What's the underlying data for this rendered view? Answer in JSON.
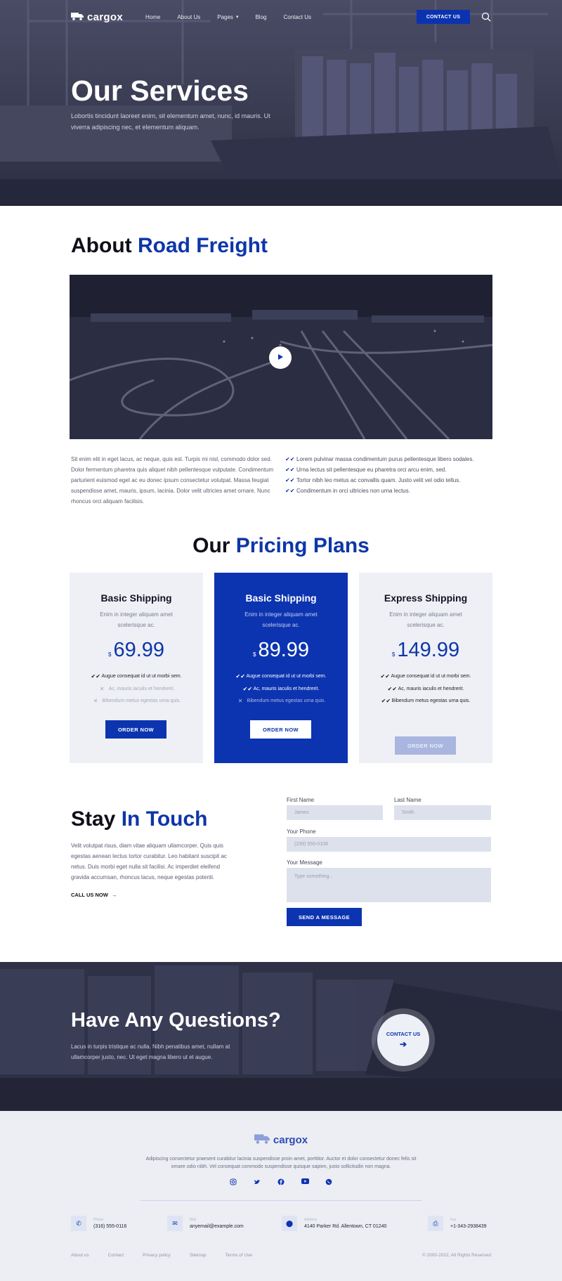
{
  "nav": {
    "brand": "cargox",
    "links": [
      "Home",
      "About Us",
      "Pages",
      "Blog",
      "Contact Us"
    ],
    "cta": "CONTACT US"
  },
  "hero": {
    "title": "Our Services",
    "subtitle": "Lobortis tincidunt laoreet enim, sit elementum amet, nunc, id mauris. Ut viverra adipiscing nec, et elementum aliquam."
  },
  "about": {
    "title_plain": "About ",
    "title_accent": "Road Freight",
    "text": "Sit enim elit in eget lacus, ac neque, quis est. Turpis mi nisl, commodo dolor sed. Dolor fermentum pharetra quis aliquet nibh pellentesque vulputate. Condimentum parturient euismod eget ac eu donec ipsum consectetur volutpat. Massa feugiat suspendisse amet, mauris, ipsum, lacinia. Dolor velit ultricies amet ornare. Nunc rhoncus orci aliquam facilisis.",
    "list": [
      "Lorem pulvinar massa condimentum purus pellentesque libero sodales.",
      "Urna lectus sit pellentesque eu pharetra orci arcu enim, sed.",
      "Tortor nibh leo metus ac convallis quam. Justo velit vel odio tellus.",
      "Condimentum in orci ultricies non urna lectus."
    ]
  },
  "pricing": {
    "title_plain": "Our ",
    "title_accent": "Pricing Plans",
    "plans": [
      {
        "name": "Basic Shipping",
        "desc": "Enim in integer aliquam amet scelerisque ac.",
        "currency": "$",
        "price": "69.99",
        "features": [
          "Augue consequat id ut ut morbi sem.",
          "Ac, mauris iaculis et hendrerit.",
          "Bibendum metus egestas urna quis."
        ],
        "button": "ORDER NOW"
      },
      {
        "name": "Basic Shipping",
        "desc": "Enim in integer aliquam amet scelerisque ac.",
        "currency": "$",
        "price": "89.99",
        "features": [
          "Augue consequat id ut ut morbi sem.",
          "Ac, mauris iaculis et hendrerit.",
          "Bibendum metus egestas urna quis."
        ],
        "button": "ORDER NOW"
      },
      {
        "name": "Express Shipping",
        "desc": "Enim in integer aliquam amet scelerisque ac.",
        "currency": "$",
        "price": "149.99",
        "features": [
          "Augue consequat id ut ut morbi sem.",
          "Ac, mauris iaculis et hendrerit.",
          "Bibendum metus egestas urna quis."
        ],
        "button": "ORDER NOW"
      }
    ]
  },
  "contact": {
    "title_plain": "Stay ",
    "title_accent": "In Touch",
    "text": "Velit volutpat risus, diam vitae aliquam ullamcorper. Quis quis egestas aenean lectus tortor curabitur. Leo habitant suscipit ac netus. Duis morbi eget nulla sit facilisi. Ac imperdiet eleifend gravida accumsan, rhoncus lacus, neque egestas potenti.",
    "call_link": "CALL US NOW",
    "form": {
      "first_name_label": "First Name",
      "first_name_placeholder": "James",
      "last_name_label": "Last Name",
      "last_name_placeholder": "Smith",
      "phone_label": "Your Phone",
      "phone_placeholder": "(239) 555-0108",
      "message_label": "Your Message",
      "message_placeholder": "Type something...",
      "submit": "SEND A MESSAGE"
    }
  },
  "questions": {
    "title": "Have Any Questions?",
    "text": "Lacus in turpis tristique ac nulla. Nibh penatibus amet, nullam at ullamcorper justo, nec. Ut eget magna libero ut et augue.",
    "cta": "CONTACT US"
  },
  "footer": {
    "brand": "cargox",
    "desc": "Adipiscing consectetur praesent curabitur lacinia suspendisse proin amet, porttitor. Auctor et dolor consectetur donec felis sit ornare odio nibh. Vel consequat commodo suspendisse quisque sapien, justo sollicitudin non magna.",
    "contacts": [
      {
        "label": "Phone",
        "value": "(316) 555-0116",
        "icon": "phone-icon"
      },
      {
        "label": "Mail",
        "value": "anyemail@example.com",
        "icon": "mail-icon"
      },
      {
        "label": "Address",
        "value": "4140 Parker Rd. Allentown, CT 01240",
        "icon": "location-icon"
      },
      {
        "label": "Fax",
        "value": "+1-343-2938439",
        "icon": "fax-icon"
      }
    ],
    "links": [
      "About us",
      "Contact",
      "Privacy policy",
      "Sitemap",
      "Terms of Use"
    ],
    "copyright": "© 2000-2022, All Rights Reserved"
  },
  "colors": {
    "brand": "#0c34b0",
    "dark_overlay": "#2b2d42",
    "light_bg": "#eceef4"
  }
}
